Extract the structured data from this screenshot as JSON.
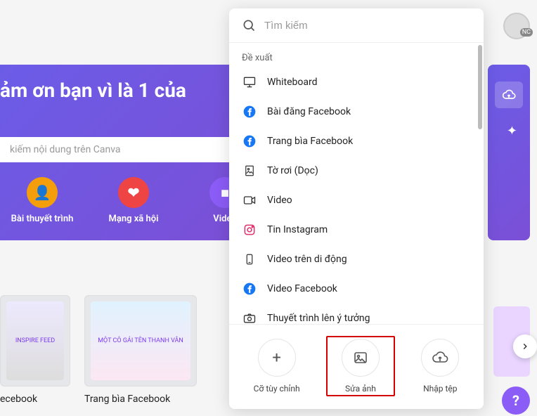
{
  "hero": {
    "title": "ảm ơn bạn vì là 1 của",
    "search_placeholder": "kiếm nội dung trên Canva"
  },
  "categories": [
    {
      "label": "Bài thuyết trình",
      "glyph": "👤"
    },
    {
      "label": "Mạng xã hội",
      "glyph": "❤"
    },
    {
      "label": "Video",
      "glyph": "■"
    }
  ],
  "templates": [
    {
      "label": "ecebook",
      "thumb_text": "INSPIRE FEED"
    },
    {
      "label": "Trang bìa Facebook",
      "thumb_text": "MỘT CÔ GÁI TÊN THANH VÂN"
    }
  ],
  "panel": {
    "search_placeholder": "Tìm kiếm",
    "suggested_header": "Đề xuất",
    "items": [
      {
        "label": "Whiteboard",
        "icon": "whiteboard"
      },
      {
        "label": "Bài đăng Facebook",
        "icon": "facebook"
      },
      {
        "label": "Trang bìa Facebook",
        "icon": "facebook"
      },
      {
        "label": "Tờ rơi (Dọc)",
        "icon": "flyer"
      },
      {
        "label": "Video",
        "icon": "video"
      },
      {
        "label": "Tin Instagram",
        "icon": "instagram"
      },
      {
        "label": "Video trên di động",
        "icon": "mobile"
      },
      {
        "label": "Video Facebook",
        "icon": "facebook"
      },
      {
        "label": "Thuyết trình lên ý tưởng",
        "icon": "camera"
      }
    ],
    "footer": [
      {
        "label": "Cỡ tùy chỉnh",
        "glyph": "+"
      },
      {
        "label": "Sửa ảnh",
        "glyph": "image"
      },
      {
        "label": "Nhập tệp",
        "glyph": "upload"
      }
    ]
  },
  "avatar": {
    "badge": "NC"
  },
  "fab": {
    "label": "?"
  },
  "hidden_labels": {
    "flyer": "Tờ rơi (Dọc)",
    "video": "Video"
  }
}
